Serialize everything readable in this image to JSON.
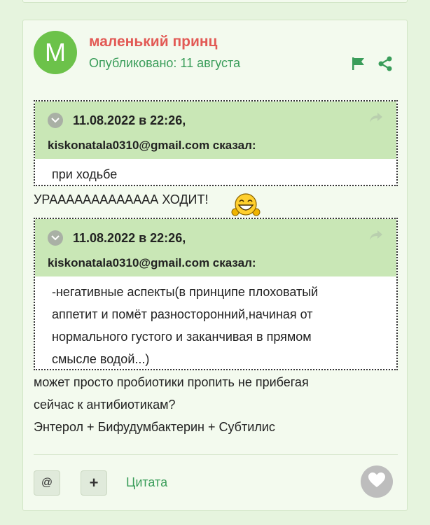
{
  "post": {
    "avatar_letter": "M",
    "author": "маленький принц",
    "published": "Опубликовано: 11 августа"
  },
  "quotes": [
    {
      "date": "11.08.2022 в 22:26,",
      "author_line": "kiskonatala0310@gmail.com сказал:",
      "lines": [
        "при ходьбе"
      ]
    },
    {
      "date": "11.08.2022 в 22:26,",
      "author_line": "kiskonatala0310@gmail.com сказал:",
      "lines": [
        "-негативные аспекты(в принципе плоховатый",
        "аппетит и помёт разносторонний,начиная от",
        "нормального густого и заканчивая в прямом",
        "смысле водой...)"
      ]
    }
  ],
  "body": {
    "line1": "УРААААААААААААА ХОДИТ!",
    "line2": "может просто пробиотики пропить не прибегая",
    "line3": "сейчас к антибиотикам?",
    "line4": "Энтерол + Бифудумбактерин + Субтилис"
  },
  "actions": {
    "mention_label": "@",
    "add_label": "+",
    "quote_label": "Цитата"
  },
  "colors": {
    "accent_green": "#3a9d5a",
    "author_red": "#e25a55",
    "quote_header": "#c9e7b6",
    "avatar": "#6cc24a"
  },
  "icons": [
    "flag-icon",
    "share-icon",
    "collapse-icon",
    "reply-icon",
    "laughing-emoji",
    "heart-icon"
  ]
}
